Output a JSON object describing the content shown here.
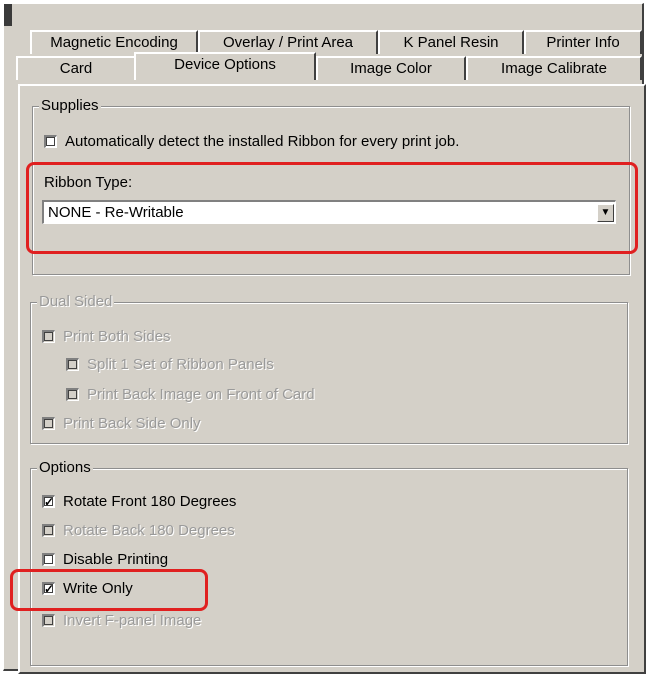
{
  "tabs_row1": [
    "Magnetic Encoding",
    "Overlay / Print Area",
    "K Panel Resin",
    "Printer Info"
  ],
  "tabs_row2": [
    "Card",
    "Device Options",
    "Image Color",
    "Image Calibrate"
  ],
  "active_tab": "Device Options",
  "supplies": {
    "legend": "Supplies",
    "auto_detect": {
      "label": "Automatically detect the installed Ribbon for every print job.",
      "checked": false,
      "mark": ""
    },
    "ribbon_type_label": "Ribbon Type:",
    "ribbon_type_value": "NONE - Re-Writable",
    "dropdown_arrow": "▼"
  },
  "dual_sided": {
    "legend": "Dual Sided",
    "enabled": false,
    "items": [
      {
        "label": "Print Both Sides",
        "checked": false,
        "mark": ""
      },
      {
        "label": "Split 1 Set of Ribbon Panels",
        "checked": false,
        "mark": ""
      },
      {
        "label": "Print Back Image on Front of Card",
        "checked": false,
        "mark": ""
      },
      {
        "label": "Print Back Side Only",
        "checked": false,
        "mark": ""
      }
    ]
  },
  "options": {
    "legend": "Options",
    "items": [
      {
        "label": "Rotate Front 180 Degrees",
        "checked": true,
        "enabled": true,
        "mark": "✓"
      },
      {
        "label": "Rotate Back 180 Degrees",
        "checked": false,
        "enabled": false,
        "mark": ""
      },
      {
        "label": "Disable Printing",
        "checked": false,
        "enabled": true,
        "mark": ""
      },
      {
        "label": "Write Only",
        "checked": true,
        "enabled": true,
        "mark": "✓"
      },
      {
        "label": "Invert F-panel Image",
        "checked": false,
        "enabled": false,
        "mark": ""
      }
    ]
  },
  "colors": {
    "highlight": "#e02020",
    "dialog": "#d4d0c8",
    "disabled_text": "#9a9a9a"
  }
}
